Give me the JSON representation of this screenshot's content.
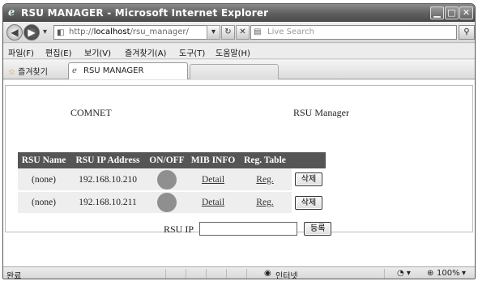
{
  "browser": {
    "window_title": "RSU MANAGER - Microsoft Internet Explorer",
    "address": {
      "scheme": "http://",
      "host": "localhost",
      "path": "/rsu_manager/"
    },
    "search_placeholder": "Live Search",
    "menu": [
      "파일(F)",
      "편집(E)",
      "보기(V)",
      "즐겨찾기(A)",
      "도구(T)",
      "도움말(H)"
    ],
    "favorites_label": "즐겨찾기",
    "tab_label": "RSU MANAGER",
    "status": {
      "left": "완료",
      "zone": "인터넷",
      "zoom": "100%"
    }
  },
  "page": {
    "brand": "COMNET",
    "app_title": "RSU Manager",
    "table": {
      "headers": [
        "RSU Name",
        "RSU IP Address",
        "ON/OFF",
        "MIB INFO",
        "Reg. Table",
        ""
      ],
      "rows": [
        {
          "name": "(none)",
          "ip": "192.168.10.210",
          "mib": "Detail",
          "reg": "Reg.",
          "delete": "삭제",
          "status_color": "#8f8f8f"
        },
        {
          "name": "(none)",
          "ip": "192.168.10.211",
          "mib": "Detail",
          "reg": "Reg.",
          "delete": "삭제",
          "status_color": "#8f8f8f"
        }
      ]
    },
    "register_form": {
      "label": "RSU IP",
      "value": "",
      "button": "등록"
    }
  },
  "colors": {
    "header_bg": "#555555",
    "alt_row_bg": "#eeeeee",
    "status_off": "#8f8f8f"
  }
}
